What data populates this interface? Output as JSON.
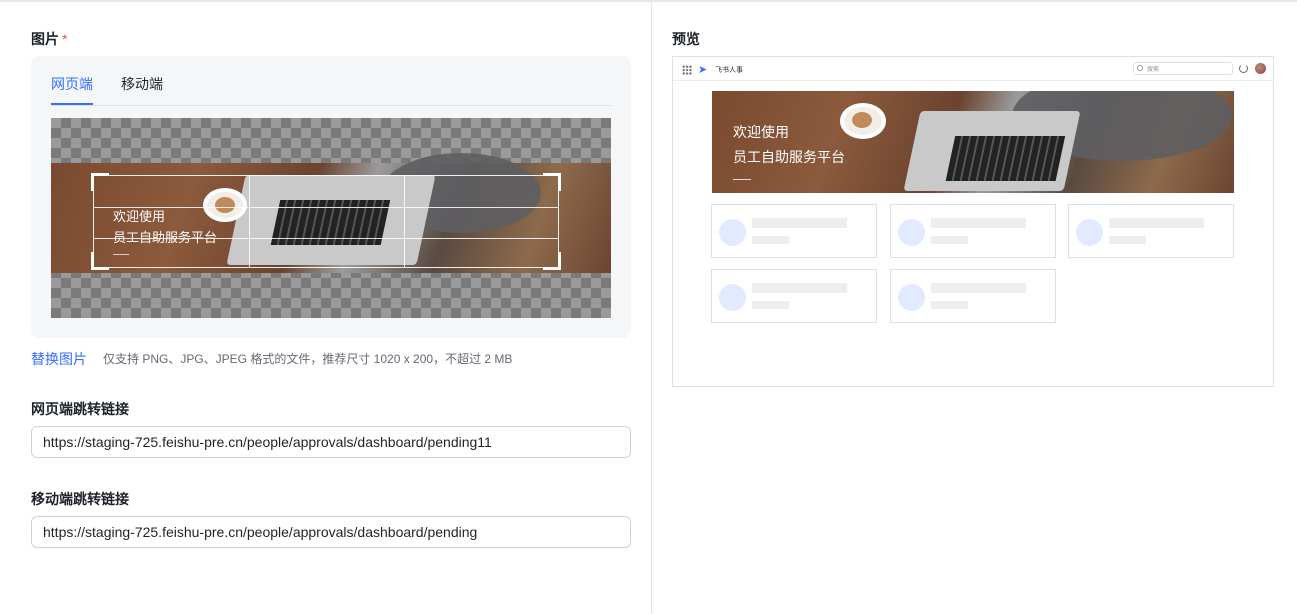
{
  "left": {
    "image_label": "图片",
    "required_mark": "*",
    "tabs": [
      {
        "label": "网页端",
        "active": true
      },
      {
        "label": "移动端",
        "active": false
      }
    ],
    "banner_line1": "欢迎使用",
    "banner_line2": "员工自助服务平台",
    "replace_label": "替换图片",
    "hint": "仅支持 PNG、JPG、JPEG 格式的文件，推荐尺寸 1020 x 200，不超过 2 MB",
    "web_link_label": "网页端跳转链接",
    "web_link_value": "https://staging-725.feishu-pre.cn/people/approvals/dashboard/pending11",
    "mobile_link_label": "移动端跳转链接",
    "mobile_link_value": "https://staging-725.feishu-pre.cn/people/approvals/dashboard/pending"
  },
  "right": {
    "preview_label": "预览",
    "app_name": "飞书人事",
    "search_placeholder": "搜索",
    "banner_line1": "欢迎使用",
    "banner_line2": "员工自助服务平台",
    "skeleton_cards": 5
  },
  "colors": {
    "accent": "#3370ff",
    "required": "#f54a45",
    "skeleton_circle": "#e1eaff"
  }
}
